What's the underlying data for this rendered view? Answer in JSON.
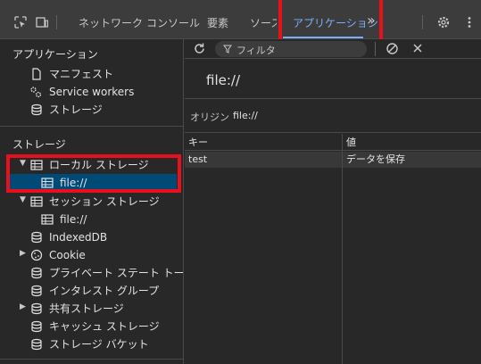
{
  "tabbar": {
    "tabs": [
      {
        "label": "ネットワーク",
        "active": false
      },
      {
        "label": "コンソール",
        "active": false
      },
      {
        "label": "要素",
        "active": false
      },
      {
        "label": "ソース",
        "active": false
      },
      {
        "label": "アプリケーション",
        "active": true
      }
    ],
    "overflow_label": "»",
    "icons": [
      "inspect-icon",
      "device-toggle-icon",
      "settings-icon",
      "more-icon"
    ]
  },
  "sidebar": {
    "app_section_title": "アプリケーション",
    "app_items": [
      {
        "label": "マニフェスト",
        "icon": "file-icon"
      },
      {
        "label": "Service workers",
        "icon": "gears-icon"
      },
      {
        "label": "ストレージ",
        "icon": "database-icon"
      }
    ],
    "storage_section_title": "ストレージ",
    "storage_items": [
      {
        "label": "ローカル ストレージ",
        "icon": "table-icon",
        "expanded": true
      },
      {
        "label": "file://",
        "icon": "table-icon",
        "selected": true
      },
      {
        "label": "セッション ストレージ",
        "icon": "table-icon",
        "expanded": true
      },
      {
        "label": "file://",
        "icon": "table-icon"
      },
      {
        "label": "IndexedDB",
        "icon": "database-icon"
      },
      {
        "label": "Cookie",
        "icon": "cookie-icon",
        "collapsed": true
      },
      {
        "label": "プライベート ステート トークン",
        "icon": "database-icon"
      },
      {
        "label": "インタレスト グループ",
        "icon": "database-icon"
      },
      {
        "label": "共有ストレージ",
        "icon": "database-icon",
        "collapsed": true
      },
      {
        "label": "キャッシュ ストレージ",
        "icon": "database-icon"
      },
      {
        "label": "ストレージ バケット",
        "icon": "database-icon"
      }
    ]
  },
  "main": {
    "toolbar": {
      "filter_placeholder": "フィルタ",
      "icons": [
        "refresh-icon",
        "filter-icon",
        "clear-icon",
        "close-icon"
      ]
    },
    "origin_title": "file://",
    "origin_label": "オリジン",
    "origin_value": "file://",
    "table": {
      "headers": [
        "キー",
        "値"
      ],
      "rows": [
        {
          "key": "test",
          "value": "データを保存"
        }
      ]
    }
  },
  "colors": {
    "accent": "#7cacf8",
    "selected_bg": "#004a77",
    "highlight_box": "#e8101c"
  }
}
